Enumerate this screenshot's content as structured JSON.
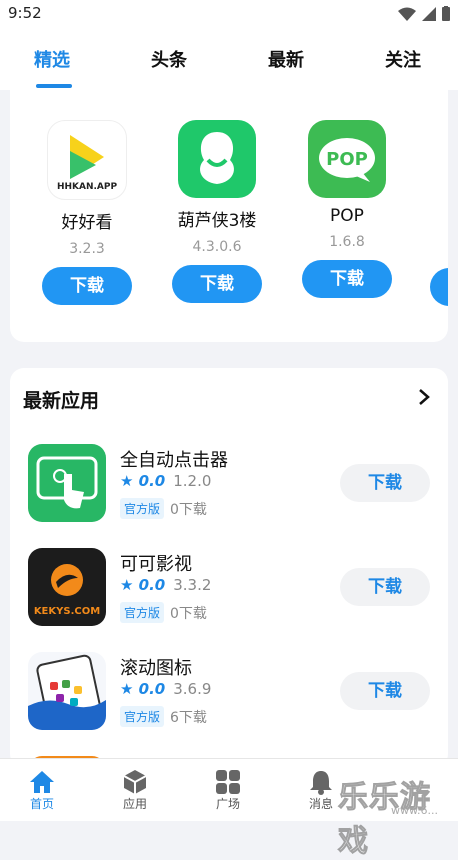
{
  "status": {
    "time": "9:52"
  },
  "tabs": [
    {
      "label": "精选"
    },
    {
      "label": "头条"
    },
    {
      "label": "最新"
    },
    {
      "label": "关注"
    }
  ],
  "featured": [
    {
      "name": "好好看",
      "version": "3.2.3",
      "button": "下载",
      "icon_text": "HHKAN.APP"
    },
    {
      "name": "葫芦侠3楼",
      "version": "4.3.0.6",
      "button": "下载"
    },
    {
      "name": "POP",
      "version": "1.6.8",
      "button": "下载",
      "icon_text": "POP"
    }
  ],
  "latest": {
    "title": "最新应用",
    "items": [
      {
        "name": "全自动点击器",
        "rating": "★ 0.0",
        "version": "1.2.0",
        "badge": "官方版",
        "downloads": "0下载",
        "button": "下载"
      },
      {
        "name": "可可影视",
        "rating": "★ 0.0",
        "version": "3.3.2",
        "badge": "官方版",
        "downloads": "0下载",
        "button": "下载",
        "icon_text": "KEKYS.COM"
      },
      {
        "name": "滚动图标",
        "rating": "★ 0.0",
        "version": "3.6.9",
        "badge": "官方版",
        "downloads": "6下载",
        "button": "下载"
      }
    ]
  },
  "nav": [
    {
      "label": "首页",
      "icon": "home-icon"
    },
    {
      "label": "应用",
      "icon": "cube-icon"
    },
    {
      "label": "广场",
      "icon": "grid-icon"
    },
    {
      "label": "消息",
      "icon": "bell-icon"
    }
  ],
  "watermark": {
    "text": "乐乐游戏",
    "url": "www.6..."
  },
  "colors": {
    "accent": "#1e88e5",
    "button": "#2196f3"
  }
}
